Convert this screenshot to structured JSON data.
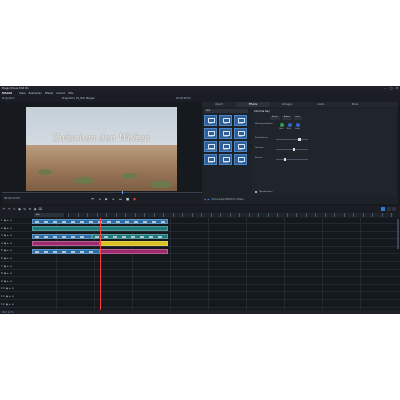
{
  "window": {
    "title": "Magix Movie Edit Pro",
    "controls": [
      "–",
      "□",
      "✕"
    ]
  },
  "menubar": {
    "logo": "MAGIX",
    "items": [
      "Datei",
      "Bearbeiten",
      "Effekte",
      "Ansicht",
      "Hilfe"
    ]
  },
  "toolstrip": {
    "left": "Programm",
    "preview_label": "Programm: 01_Film Morgen",
    "timecode": "00:00:00:00"
  },
  "preview": {
    "overlay_title": "Zwischen den Welten"
  },
  "transport": {
    "time": "00:00:12:05",
    "buttons": [
      "⏮",
      "◂",
      "▶",
      "▸",
      "⏭",
      "■",
      "●"
    ]
  },
  "media_pool": {
    "tabs": [
      "Import",
      "Effekte",
      "Vorlagen",
      "Audio",
      "Store"
    ],
    "active_tab": "Effekte",
    "filter": "Alle",
    "tiles": [
      {
        "label": "Titel"
      },
      {
        "label": "Text"
      },
      {
        "label": "Blende"
      },
      {
        "label": "Chroma"
      },
      {
        "label": "Farbe"
      },
      {
        "label": "Form"
      },
      {
        "label": "Bewegung"
      },
      {
        "label": "Maske"
      },
      {
        "label": "Stabil."
      },
      {
        "label": "Audio"
      },
      {
        "label": "Tempo"
      },
      {
        "label": "Mehr"
      }
    ],
    "props": {
      "header": "Chroma Key",
      "chips": [
        "Farbe",
        "Alpha",
        "Info"
      ],
      "rows": [
        "Hintergrundfarbe",
        "Schwellwert",
        "Toleranz",
        "Kanten",
        "Überblenden"
      ],
      "color_labels": [
        "Grün",
        "Blau",
        "Farbe"
      ],
      "colors": [
        "#2d9c4b",
        "#2f62c8",
        "#2f62c8"
      ],
      "levels": [
        0.74,
        0.55,
        0.25
      ]
    },
    "bottom": "Chroma-Key-Effekt für Videos"
  },
  "timeline": {
    "project_select": "Alle",
    "tools": [
      "↶",
      "↷",
      "✂",
      "▣",
      "⇆",
      "⟲",
      "◉",
      "⌧"
    ]
  },
  "tracks": {
    "rows": [
      "1 ◉ ▸ ⊙",
      "2 ◉ ▸ ⊙",
      "3 ◉ ▸ ⊙",
      "4 ◉ ▸ ⊙",
      "5 ◉ ▸ ⊙",
      "6 ◉ ▸ ⊙",
      "7 ◉ ▸ ⊙",
      "8 ◉ ▸ ⊙",
      "9 ◉ ▸ ⊙",
      "10 ◉ ▸ ⊙",
      "11 ◉ ▸ ⊙",
      "12 ◉ ▸ ⊙"
    ]
  },
  "status": {
    "text": "CPU: 14 %"
  },
  "colors": {
    "accent": "#2f7bd6",
    "clip_blue": "#2a6ea8",
    "clip_teal": "#1d7a7a",
    "clip_yellow": "#d9c21f",
    "clip_magenta": "#9b2b6d",
    "playhead": "#ff3b3b"
  }
}
